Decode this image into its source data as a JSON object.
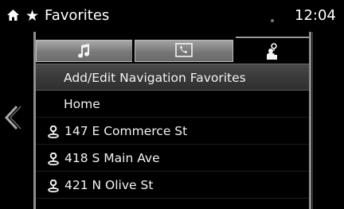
{
  "header": {
    "star": "★",
    "title": "Favorites",
    "clock": "12:04"
  },
  "tabs": [
    {
      "name": "music",
      "icon": "music-note-icon",
      "active": false
    },
    {
      "name": "phone",
      "icon": "phone-icon",
      "active": false
    },
    {
      "name": "navigation",
      "icon": "navigation-favorite-icon",
      "active": true
    }
  ],
  "list": {
    "items": [
      {
        "label": "Add/Edit Navigation Favorites",
        "icon": null,
        "selected": true
      },
      {
        "label": "Home",
        "icon": null,
        "selected": false
      },
      {
        "label": "147 E Commerce St",
        "icon": "person-pin-icon",
        "selected": false
      },
      {
        "label": "418 S Main Ave",
        "icon": "person-pin-icon",
        "selected": false
      },
      {
        "label": "421 N Olive St",
        "icon": "person-pin-icon",
        "selected": false
      }
    ]
  },
  "colors": {
    "background": "#000000",
    "text": "#f2f2f2",
    "tab_gray": "#8a8a8a",
    "selected_row": "#404040"
  }
}
